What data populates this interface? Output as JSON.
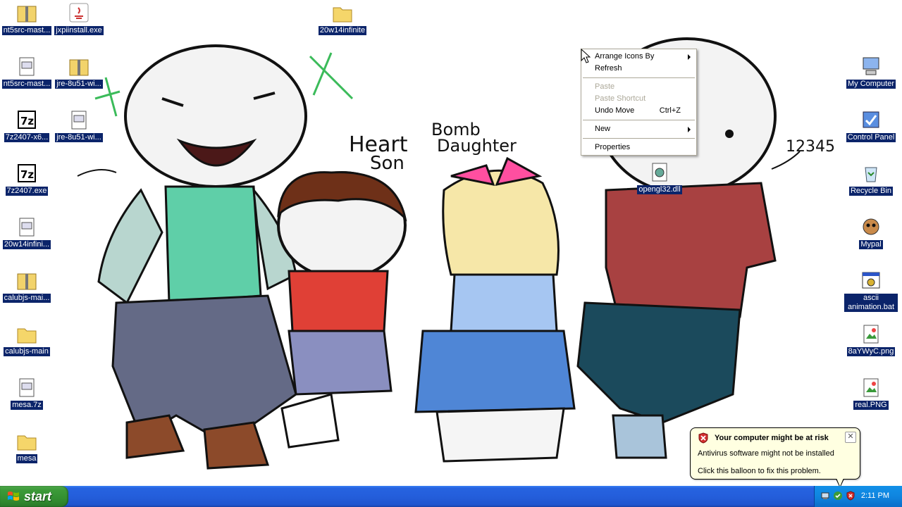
{
  "desktop_icons_left": [
    {
      "label": "nt5src-mast...",
      "icon": "zip-folder-icon"
    },
    {
      "label": "jxpiinstall.exe",
      "icon": "java-icon"
    },
    {
      "label": "nt5src-mast...",
      "icon": "file-window-icon"
    },
    {
      "label": "jre-8u51-wi...",
      "icon": "zip-folder-icon"
    },
    {
      "label": "7z2407-x6...",
      "icon": "7z-icon"
    },
    {
      "label": "jre-8u51-wi...",
      "icon": "file-window-icon"
    },
    {
      "label": "7z2407.exe",
      "icon": "7z-icon"
    },
    {
      "label": "20w14infini...",
      "icon": "file-window-icon"
    },
    {
      "label": "calubjs-mai...",
      "icon": "zip-folder-icon"
    },
    {
      "label": "calubjs-main",
      "icon": "folder-icon"
    },
    {
      "label": "mesa.7z",
      "icon": "file-window-icon"
    },
    {
      "label": "mesa",
      "icon": "folder-icon"
    },
    {
      "label": "20w14infinite",
      "icon": "folder-icon"
    },
    {
      "label": "opengl32.dll",
      "icon": "dll-icon"
    }
  ],
  "desktop_icons_right": [
    {
      "label": "My Computer",
      "icon": "computer-icon"
    },
    {
      "label": "Control Panel",
      "icon": "control-panel-icon"
    },
    {
      "label": "Recycle Bin",
      "icon": "recycle-bin-icon"
    },
    {
      "label": "Mypal",
      "icon": "mypal-icon"
    },
    {
      "label": "ascii animation.bat",
      "icon": "batch-file-icon"
    },
    {
      "label": "8aYWyC.png",
      "icon": "image-file-icon"
    },
    {
      "label": "real.PNG",
      "icon": "image-file-icon"
    }
  ],
  "context_menu": {
    "arrange_icons_by": "Arrange Icons By",
    "refresh": "Refresh",
    "paste": "Paste",
    "paste_shortcut": "Paste Shortcut",
    "undo_move": "Undo Move",
    "undo_move_accel": "Ctrl+Z",
    "new": "New",
    "properties": "Properties"
  },
  "wallpaper_text": {
    "heart_son_1": "Heart",
    "heart_son_2": "Son",
    "bomb_daughter_1": "Bomb",
    "bomb_daughter_2": "Daughter",
    "number": "12345"
  },
  "balloon": {
    "title": "Your computer might be at risk",
    "line1": "Antivirus software might not be installed",
    "line2": "Click this balloon to fix this problem."
  },
  "taskbar": {
    "start_label": "start",
    "clock": "2:11 PM"
  },
  "colors": {
    "selection": "#0b246a",
    "taskbar_blue": "#245edb",
    "start_green": "#3c9a39",
    "balloon_bg": "#ffffe1"
  }
}
